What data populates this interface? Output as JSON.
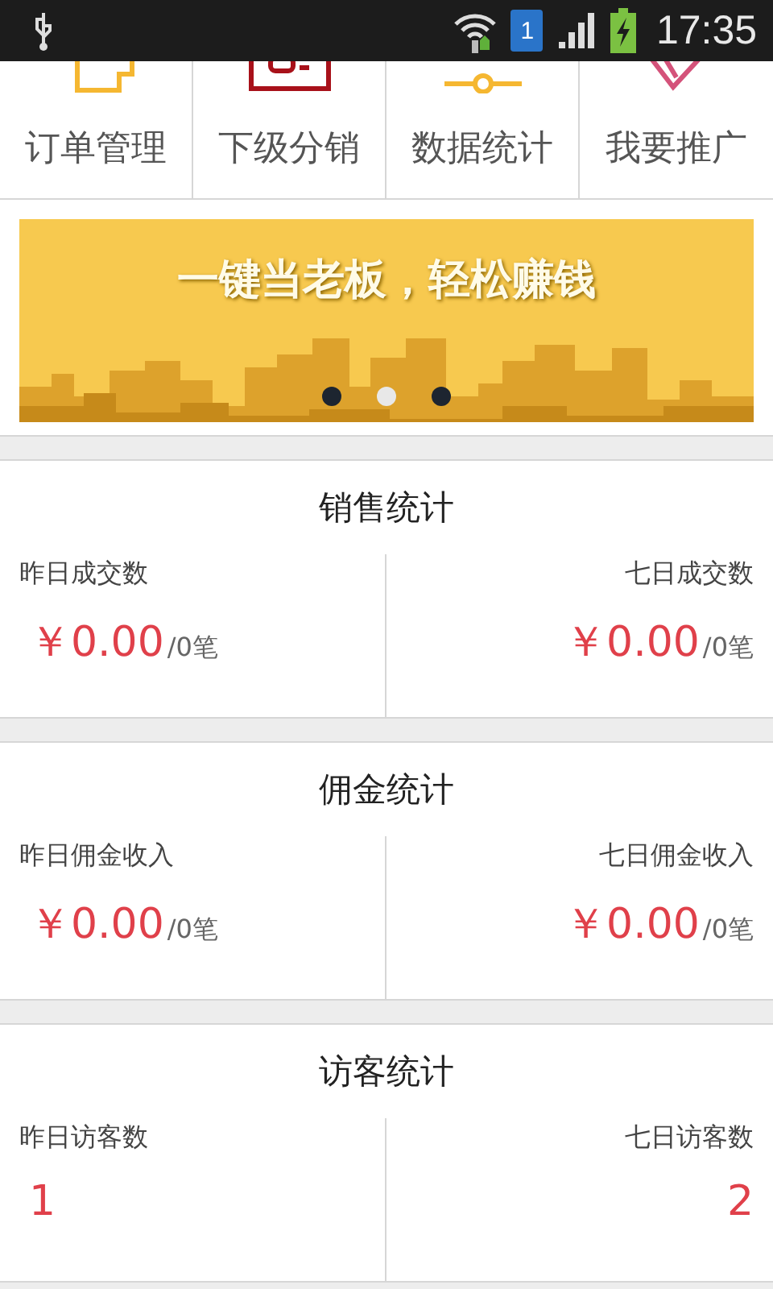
{
  "status_bar": {
    "time": "17:35",
    "sim_slot": "1"
  },
  "nav": [
    {
      "label": "订单管理",
      "kind": "orders"
    },
    {
      "label": "下级分销",
      "kind": "team"
    },
    {
      "label": "数据统计",
      "kind": "stats"
    },
    {
      "label": "我要推广",
      "kind": "promote"
    }
  ],
  "banner": {
    "headline": "一键当老板，轻松赚钱",
    "dots": [
      {
        "selected": false
      },
      {
        "selected": true
      },
      {
        "selected": false
      }
    ]
  },
  "sections": [
    {
      "title": "销售统计",
      "cells": [
        {
          "label": "昨日成交数",
          "amount": "￥0.00",
          "count": "/0笔"
        },
        {
          "label": "七日成交数",
          "amount": "￥0.00",
          "count": "/0笔"
        }
      ]
    },
    {
      "title": "佣金统计",
      "cells": [
        {
          "label": "昨日佣金收入",
          "amount": "￥0.00",
          "count": "/0笔"
        },
        {
          "label": "七日佣金收入",
          "amount": "￥0.00",
          "count": "/0笔"
        }
      ]
    },
    {
      "title": "访客统计",
      "cells": [
        {
          "label": "昨日访客数",
          "amount": "1"
        },
        {
          "label": "七日访客数",
          "amount": "2"
        }
      ]
    }
  ]
}
